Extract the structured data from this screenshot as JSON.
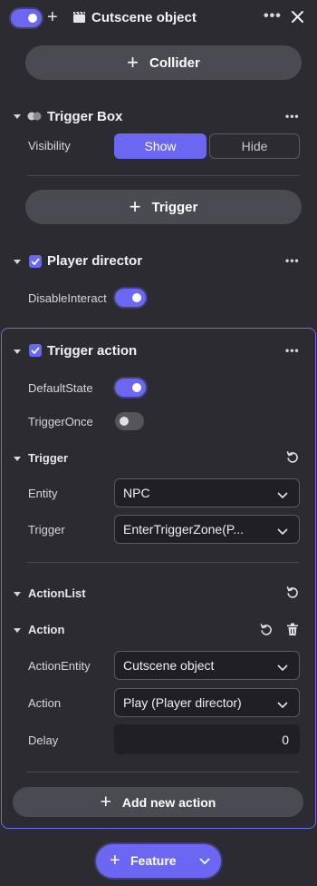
{
  "header": {
    "title": "Cutscene object",
    "plus": "+"
  },
  "collider_button": {
    "label": "Collider",
    "plus": "+"
  },
  "trigger_box": {
    "title": "Trigger Box",
    "visibility_label": "Visibility",
    "options": [
      "Show",
      "Hide"
    ],
    "selected": "Show"
  },
  "trigger_button": {
    "label": "Trigger",
    "plus": "+"
  },
  "player_director": {
    "title": "Player director",
    "checked": true,
    "disable_interact_label": "DisableInteract",
    "disable_interact_on": true
  },
  "trigger_action": {
    "title": "Trigger action",
    "checked": true,
    "default_state_label": "DefaultState",
    "default_state_on": true,
    "trigger_once_label": "TriggerOnce",
    "trigger_once_on": false,
    "trigger_section": {
      "title": "Trigger",
      "entity_label": "Entity",
      "entity_value": "NPC",
      "trigger_label": "Trigger",
      "trigger_value": "EnterTriggerZone(P..."
    },
    "action_list": {
      "title": "ActionList",
      "action_title": "Action",
      "action_entity_label": "ActionEntity",
      "action_entity_value": "Cutscene object",
      "action_label": "Action",
      "action_value": "Play (Player director)",
      "delay_label": "Delay",
      "delay_value": "0"
    },
    "add_action": {
      "label": "Add new action",
      "plus": "+"
    }
  },
  "feature_button": {
    "label": "Feature",
    "plus": "+"
  },
  "colors": {
    "background": "#2b2b31",
    "accent": "#6b67f2",
    "button": "#4a4a52",
    "selection_border": "#6a6cf0",
    "field_bg": "#1f1f24"
  }
}
